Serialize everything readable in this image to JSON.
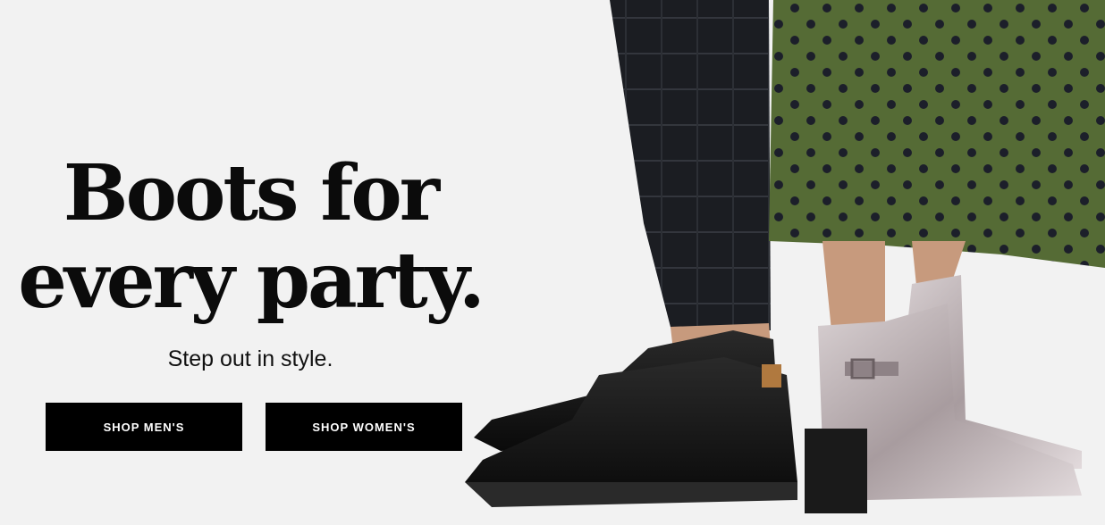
{
  "hero": {
    "headline_line1": "Boots for",
    "headline_line2": "every party.",
    "subhead": "Step out in style.",
    "buttons": {
      "shop_men": "SHOP MEN'S",
      "shop_women": "SHOP WOMEN'S"
    },
    "photo": {
      "description_icon": "boots-photo",
      "colors": {
        "background": "#f2f2f2",
        "skirt": "#556b35",
        "polka_dots": "#1c1f2a",
        "pants": "#1b1d22",
        "black_boot": "#121212",
        "metallic_boot": "#b9aeb1",
        "skin": "#c79a7d"
      }
    }
  }
}
